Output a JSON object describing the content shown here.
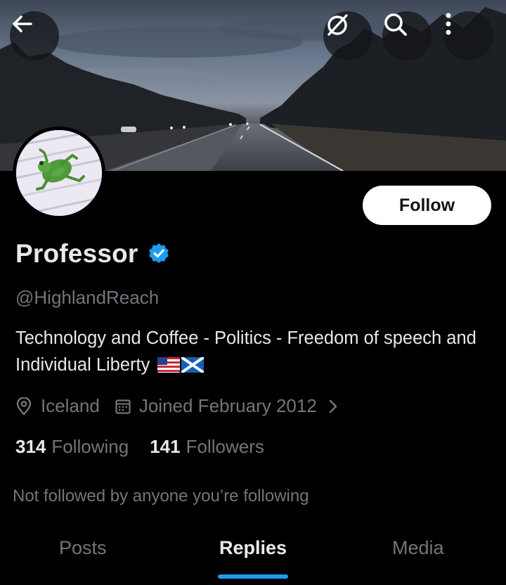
{
  "profile": {
    "display_name": "Professor",
    "handle": "@HighlandReach",
    "bio": "Technology and Coffee - Politics - Freedom of speech and Individual Liberty",
    "location": "Iceland",
    "joined": "Joined February 2012",
    "following_count": "314",
    "following_label": "Following",
    "followers_count": "141",
    "followers_label": "Followers",
    "not_followed_text": "Not followed by anyone you’re following",
    "verified": true
  },
  "actions": {
    "follow_label": "Follow"
  },
  "tabs": [
    {
      "label": "Posts",
      "active": false
    },
    {
      "label": "Replies",
      "active": true
    },
    {
      "label": "Media",
      "active": false
    }
  ],
  "icons": {
    "back": "arrow-left-icon",
    "grok": "grok-icon",
    "search": "search-icon",
    "more": "more-vertical-icon",
    "verified": "verified-badge-icon",
    "location": "location-pin-icon",
    "calendar": "calendar-icon",
    "chevron": "chevron-right-icon"
  },
  "colors": {
    "background": "#000000",
    "primary_text": "#e7e9ea",
    "secondary_text": "#71767b",
    "accent": "#1d9bf0",
    "follow_bg": "#ffffff"
  }
}
